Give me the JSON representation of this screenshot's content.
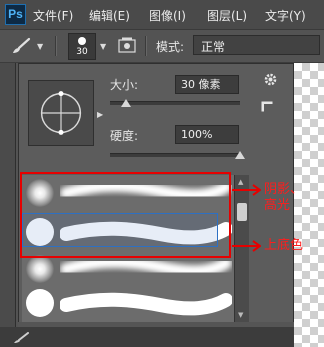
{
  "menubar": {
    "logo": "Ps",
    "items": [
      "文件(F)",
      "编辑(E)",
      "图像(I)",
      "图层(L)",
      "文字(Y)"
    ]
  },
  "options": {
    "brush_size_value": "30",
    "mode_label": "模式:",
    "mode_value": "正常"
  },
  "brush_panel": {
    "size_label": "大小:",
    "size_value": "30 像素",
    "size_fraction": 0.12,
    "hardness_label": "硬度:",
    "hardness_value": "100%",
    "hardness_fraction": 1.0,
    "brushes": [
      {
        "type": "soft"
      },
      {
        "type": "hard",
        "selected": true
      },
      {
        "type": "soft"
      },
      {
        "type": "hard"
      }
    ]
  },
  "annotations": {
    "top_label": "阴影、\n高光",
    "bottom_label": "上底色",
    "color": "#ff1d1d"
  },
  "colors": {
    "selection_blue": "#2d70c4",
    "annotation_red": "#e60000"
  }
}
